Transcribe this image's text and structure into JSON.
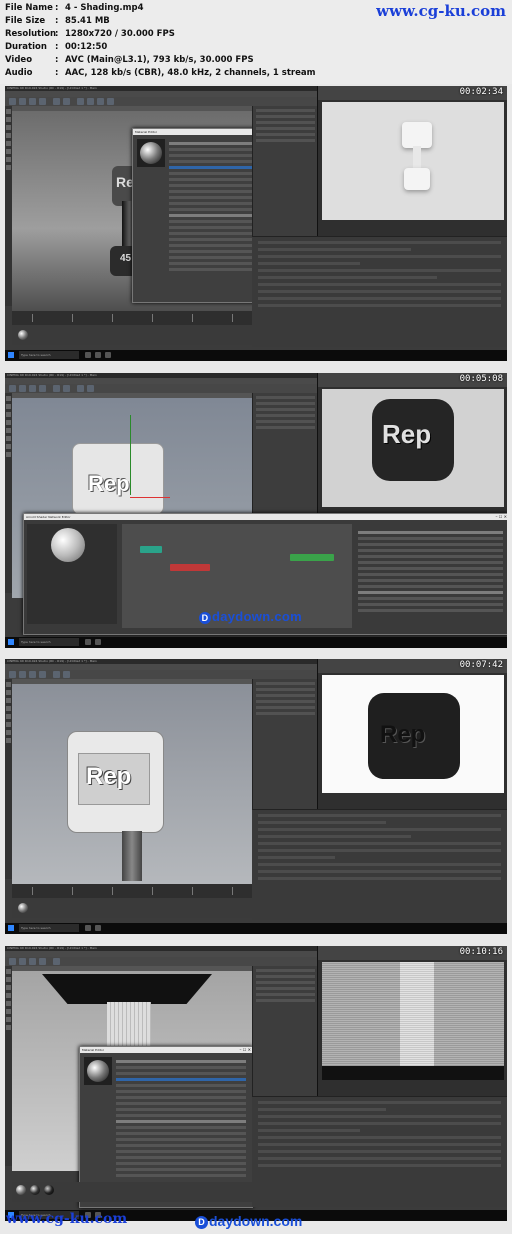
{
  "header": {
    "rows": [
      {
        "key": "File Name",
        "value": "4 - Shading.mp4"
      },
      {
        "key": "File Size",
        "value": "85.41 MB"
      },
      {
        "key": "Resolution",
        "value": "1280x720 / 30.000 FPS"
      },
      {
        "key": "Duration",
        "value": "00:12:50"
      },
      {
        "key": "Video",
        "value": "AVC (Main@L3.1), 793 kb/s, 30.000 FPS"
      },
      {
        "key": "Audio",
        "value": "AAC, 128 kb/s (CBR), 48.0 kHz, 2 channels, 1 stream"
      }
    ],
    "watermark": "www.cg-ku.com"
  },
  "frames": [
    {
      "timestamp": "00:02:34"
    },
    {
      "timestamp": "00:05:08"
    },
    {
      "timestamp": "00:07:42"
    },
    {
      "timestamp": "00:10:16"
    }
  ],
  "app": {
    "title": "CINEMA 4D R19.024 Studio (RC - R19) - [Untitled 1 *] - Main",
    "menus": [
      "File",
      "Edit",
      "Create",
      "Select",
      "Mesh",
      "Snap",
      "Animate",
      "Simulate",
      "Render",
      "Sculpt",
      "Motion Tracker",
      "MoGraph",
      "Character",
      "Pipeline",
      "Plugins",
      "RealFlow",
      "Arnold",
      "Script",
      "Window",
      "Help"
    ],
    "rep_text": "Rep",
    "plate_number": "45",
    "taskbar_search": "Type here to search"
  },
  "dialogs": {
    "material_editor": "Material Editor",
    "shader_network": "Arnold Shader Network Editor",
    "ipr": "Arnold IPR Window"
  },
  "watermarks": {
    "middle": "daydown.com",
    "bottom_left": "www.cg-ku.com",
    "bottom_middle": "daydown.com"
  }
}
